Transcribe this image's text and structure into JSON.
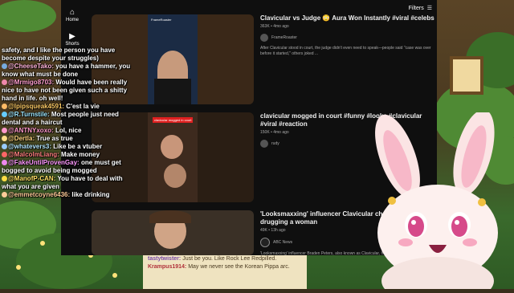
{
  "youtube": {
    "rail": [
      {
        "icon": "home-icon",
        "label": "Home"
      },
      {
        "icon": "shorts-icon",
        "label": "Shorts"
      }
    ],
    "filters_label": "Filters",
    "videos": [
      {
        "title": "Clavicular vs Judge 😳 Aura Won Instantly #viral #celebs",
        "views": "363K • 4mo ago",
        "channel": "FrameRoaster",
        "description": "After Clavicular stood in court, the judge didn't even need to speak—people said \"case was over before it started,\" others joked ...",
        "thumb_header": "FrameRoaster"
      },
      {
        "title": "clavicular mogged in court #funny #looks #clavicular #viral #reaction",
        "views": "150K • 4mo ago",
        "channel": "rudy",
        "thumb_caption": "clavicular mogged in court"
      },
      {
        "title": "'Looksmaxxing' influencer Clavicular charged with drugging a woman",
        "views": "49K • 13h ago",
        "channel": "ABC News",
        "description": "'Looksmaxxing' influencer Braden Peters, also known as Clavicular, ha..."
      }
    ]
  },
  "chat": [
    {
      "user": "",
      "text": "safety, and I like the person you have become despite your struggles)",
      "color": "#ffffff"
    },
    {
      "user": "@CheeseTako:",
      "text": "you have a hammer, you know what must be done",
      "color": "#ffb3d9"
    },
    {
      "user": "@Mrmigo8703:",
      "text": "Would have been really nice to have not been given such a shitty hand in life. oh well!",
      "color": "#ff9ecf"
    },
    {
      "user": "@lpipsqueak4591:",
      "text": "C'est la vie",
      "color": "#ffcc66"
    },
    {
      "user": "@R.Turnstile:",
      "text": "Most people just need dental and a haircut",
      "color": "#9fe8ff"
    },
    {
      "user": "@ANTNYxoxo:",
      "text": "Lol, nice",
      "color": "#ff99cc"
    },
    {
      "user": "@Dertla:",
      "text": "True as true",
      "color": "#ffd480"
    },
    {
      "user": "@whatevers3:",
      "text": "Like be a vtuber",
      "color": "#b3e6ff"
    },
    {
      "user": "@MalcolmLiang:",
      "text": "Make money",
      "color": "#ff8080"
    },
    {
      "user": "@FakeUntilProvenGay:",
      "text": "one must get bogged to avoid being mogged",
      "color": "#ff99ff"
    },
    {
      "user": "@ManofP-CAN:",
      "text": "You have to deal with what you are given",
      "color": "#ffe066"
    },
    {
      "user": "@emmetcoyne6436:",
      "text": "like drinking",
      "color": "#ffcc99"
    }
  ],
  "strip": [
    {
      "user": "tastytwister:",
      "text": "Just be you. Like Rock Lee Redpilled."
    },
    {
      "user": "Krampus1914:",
      "text": "May we never see the Korean Pippa arc."
    }
  ]
}
